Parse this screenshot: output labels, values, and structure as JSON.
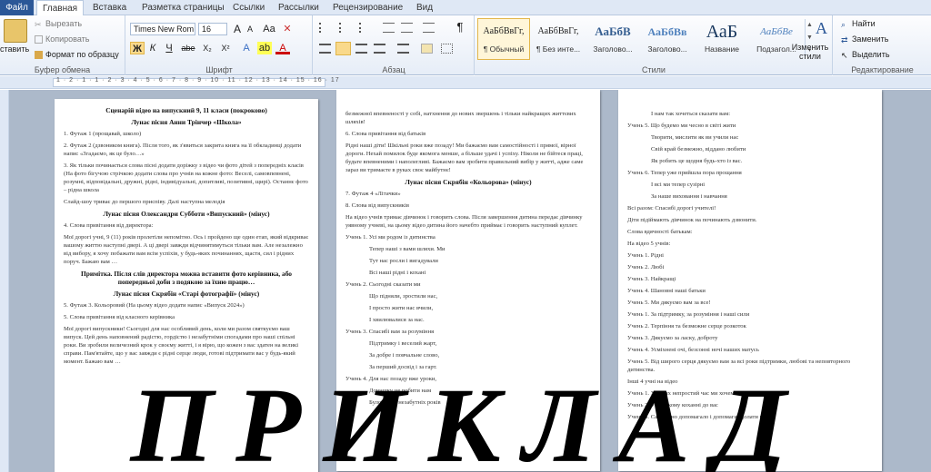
{
  "tabs": {
    "file": "Файл",
    "items": [
      "Главная",
      "Вставка",
      "Разметка страницы",
      "Ссылки",
      "Рассылки",
      "Рецензирование",
      "Вид"
    ],
    "active_index": 0
  },
  "clipboard": {
    "paste": "ставить",
    "cut": "Вырезать",
    "copy": "Копировать",
    "format_painter": "Формат по образцу",
    "label": "Буфер обмена"
  },
  "font": {
    "name": "Times New Rom",
    "size": "16",
    "grow": "A",
    "shrink": "A",
    "case": "Aa",
    "bold": "Ж",
    "italic": "К",
    "underline": "Ч",
    "strike": "abe",
    "sub": "X₂",
    "sup": "X²",
    "label": "Шрифт"
  },
  "paragraph": {
    "label": "Абзац",
    "pilcrow": "¶"
  },
  "styles": {
    "items": [
      {
        "sample": "АаБбВвГг,",
        "name": "¶ Обычный",
        "selected": true
      },
      {
        "sample": "АаБбВвГг,",
        "name": "¶ Без инте...",
        "selected": false
      },
      {
        "sample": "АаБбВ",
        "name": "Заголово...",
        "selected": false
      },
      {
        "sample": "АаБбВв",
        "name": "Заголово...",
        "selected": false
      },
      {
        "sample": "АаБ",
        "name": "Название",
        "selected": false
      },
      {
        "sample": "АаБбВе",
        "name": "Подзагол...",
        "selected": false
      }
    ],
    "change": "Изменить стили",
    "label": "Стили"
  },
  "editing": {
    "find": "Найти",
    "replace": "Заменить",
    "select": "Выделить",
    "label": "Редактирование"
  },
  "ruler": {
    "numbers": "1 · 2 · 1 · 1 · 2 · 3 · 4 · 5 · 6 · 7 · 8 · 9 · 10 · 11 · 12 · 13 · 14 · 15 · 16 · 17"
  },
  "pages": [
    {
      "lines": [
        "Сценарій відео на випускний 9, 11 класи (покроково)",
        "Лунає пісня Анни Трінчер «Школа»",
        "1. Футаж 1 (прощавай, школо)",
        "2. Футаж 2 (дзвоником книга). Після того, як з'явиться закрита книга на її обкладинці додати напис «Згадаємо, як це було…»",
        "3. Як тільки починається слова пісні додати доріжку з відео чи фото дітей з попередніх класів (На фото бігучою стрічкою додати слова про учнів на кожне фото: Веселі, самовпевнені, розумні, відповідальні, дружні, рідні, індивідуальні, допитливі, позитивні, щирі). Останнє фото – рідна школа",
        "Слайд-шоу триває до першого приспіву. Далі наступна мелодія",
        "Лунає пісня Олександри Субботи «Випускний» (мінус)",
        "4. Слова привітання від директора:",
        "Мої дорогі учні, 9 (11) років пролетіли непомітно. Ось і пройдено ще один етап, який відкриває вашому життю наступні двері. А ці двері завжди відчинятимуться тільки вам. Але незалежно від вибору, я хочу побажати вам всім успіхів, у будь-яких починаннях, щастя, сил і рідних поруч. Бажаю вам …",
        "Примітка. Після слів директора можна вставити фото керівника, або попередньої доби з подякою за їхню працю…",
        "Лунає пісня Скрябін «Старі фотографії» (мінус)",
        "5. Футаж 3. Кольоровий (На цьому відео додати напис «Випуск 2024»)",
        "5. Слова привітання від класного керівника",
        "Мої дорогі випускники! Сьогодні для нас особливий день, коли ми разом святкуємо ваш випуск. Цей день наповнений радістю, гордістю і незабутніми спогадами про наші спільні роки. Ви зробили величезний крок у своєму житті, і я вірю, що кожен з вас здатен на великі справи. Пам'ятайте, що у вас завжди є рідні серце люди, готові підтримати вас у будь-який момент. Бажаю вам …"
      ]
    },
    {
      "lines": [
        "безмежної впевненості у собі, натхнення до нових звершень і тільки найкращих життєвих шляхів!",
        "6. Слова привітання від батьків",
        "Рідні наші діти! Шкільні роки вже позаду! Ми бажаємо вам самостійності і прямої, вірної дороги. Нехай помилок буде якомога менше, а більше удачі і успіху. Ніколи не бійтеся праці, будьте впевненими і наполегливі. Бажаємо вам зробити правильний вибір у житті, адже саме зараз ви тримаєте в руках своє майбутнє!",
        "Лунає пісня Скрябін «Кольорова» (мінус)",
        "7. Футаж 4 «Літачки»",
        "8. Слова від випускників",
        "На відео учнів тримає дівчинок і говорить слова. Після завершення дитина передає дівчинку уявному учневі, на цьому відео дитина його начебто приймає і говорить наступний куплет.",
        "Учень 1. Усі ми родом із дитинства",
        "Тепер наші з вами шляхи. Ми",
        "Тут нас росли і вигадували",
        "Всі наші рідні і кохані",
        "Учень 2. Сьогодні сказати ми",
        "Що підняли, зростили нас,",
        "І просто жити нас вчили,",
        "І хвилювалися за нас.",
        "Учень 3. Спасибі вам за розуміння",
        "Підтримку і веселий жарт,",
        "За добре і повчальне слово,",
        "За перший досвід і за гарт.",
        "Учень 4. Для нас позаду вже уроки,",
        "Домашку не робити нам",
        "Було 9 (11) незабутніх років"
      ]
    },
    {
      "lines": [
        "І нам так хочеться сказати вам:",
        "Учень 5. Що будемо ми чесно в світі жити",
        "Творити, мислити як ви учили нас",
        "Свій край безмежно, віддано любити",
        "Як робить це щодня будь-хто із вас.",
        "Учень 6. Тепер уже прийшла пора прощання",
        "І всі ми тепер сузірні",
        "За наше виховання і навчання",
        "Всі разом: Спасибі дорогі учителі!",
        "Діти підіймають дівчинок на починають дзвонити.",
        "Слова вдячності батькам:",
        "На відео 5 учнів:",
        "Учень 1. Рідні",
        "Учень 2. Любі",
        "Учень 3. Найкращі",
        "Учень 4. Шановні наші батьки",
        "Учень 5. Ми дякуємо вам за все!",
        "Учень 1. За підтримку, за розуміння і наші сили",
        "Учень 2. Терпіння та безмежне серце розкоток",
        "Учень 3. Дякуємо за ласку, доброту",
        "Учень 4. Усміхнені очі, безсонні ночі наших матусь",
        "Учень 5. Від широго серця дякуємо вам за всі роки підтримки, любові та неповторного дитинства.",
        "Інші 4 учні на відео",
        "Учень 1. У таких непростий час ми хочемо вам зізнатися",
        "Учень 2. У великому коханні до вас",
        "Учень 3. Саме воно допомагало і допомагає долати нам"
      ]
    }
  ],
  "watermark": "ПРИКЛАД"
}
